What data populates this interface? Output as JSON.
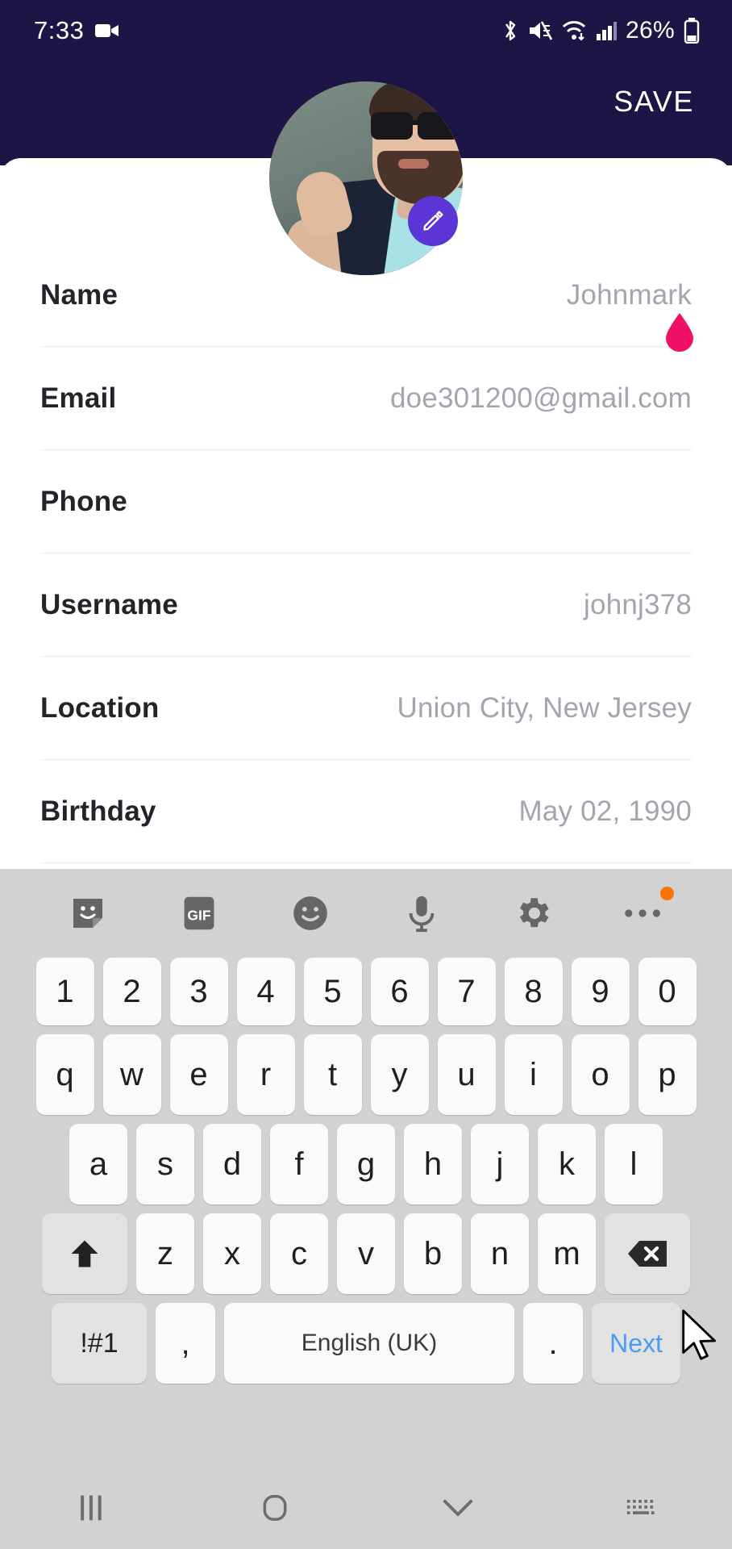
{
  "status_bar": {
    "time": "7:33",
    "battery_percent": "26%",
    "icons": [
      "video-camera-icon",
      "bluetooth-icon",
      "mute-icon",
      "wifi-icon",
      "signal-icon",
      "battery-icon"
    ]
  },
  "header": {
    "save_label": "SAVE",
    "background_color": "#1d1545",
    "avatar_alt": "profile-photo",
    "edit_badge_icon": "pencil-icon",
    "edit_badge_color": "#5b35d5"
  },
  "form": {
    "fields": [
      {
        "label": "Name",
        "value": "Johnmark"
      },
      {
        "label": "Email",
        "value": "doe301200@gmail.com"
      },
      {
        "label": "Phone",
        "value": ""
      },
      {
        "label": "Username",
        "value": "johnj378"
      },
      {
        "label": "Location",
        "value": "Union City, New Jersey"
      },
      {
        "label": "Birthday",
        "value": "May 02, 1990"
      }
    ],
    "cursor_handle_color": "#ee1164",
    "label_color": "#23242a",
    "value_color": "#a2a5ae"
  },
  "keyboard": {
    "toolbar": [
      {
        "name": "sticker-icon"
      },
      {
        "name": "gif-icon",
        "label": "GIF"
      },
      {
        "name": "emoji-icon"
      },
      {
        "name": "microphone-icon"
      },
      {
        "name": "gear-icon"
      },
      {
        "name": "more-options-icon",
        "badge": true
      }
    ],
    "row_numbers": [
      "1",
      "2",
      "3",
      "4",
      "5",
      "6",
      "7",
      "8",
      "9",
      "0"
    ],
    "row_q": [
      "q",
      "w",
      "e",
      "r",
      "t",
      "y",
      "u",
      "i",
      "o",
      "p"
    ],
    "row_a": [
      "a",
      "s",
      "d",
      "f",
      "g",
      "h",
      "j",
      "k",
      "l"
    ],
    "row_z": [
      "z",
      "x",
      "c",
      "v",
      "b",
      "n",
      "m"
    ],
    "shift_key": "shift-icon",
    "backspace_key": "backspace-icon",
    "symbols_key": "!#1",
    "comma_key": ",",
    "space_key": "English (UK)",
    "period_key": ".",
    "next_key": "Next",
    "background_color": "#d2d2d2",
    "key_color": "#fafafa",
    "mod_key_color": "#e2e2e2",
    "next_key_color": "#4a9bf5"
  },
  "nav_bar": {
    "items": [
      "recents-icon",
      "home-icon",
      "hide-keyboard-icon",
      "keyboard-switch-icon"
    ]
  }
}
